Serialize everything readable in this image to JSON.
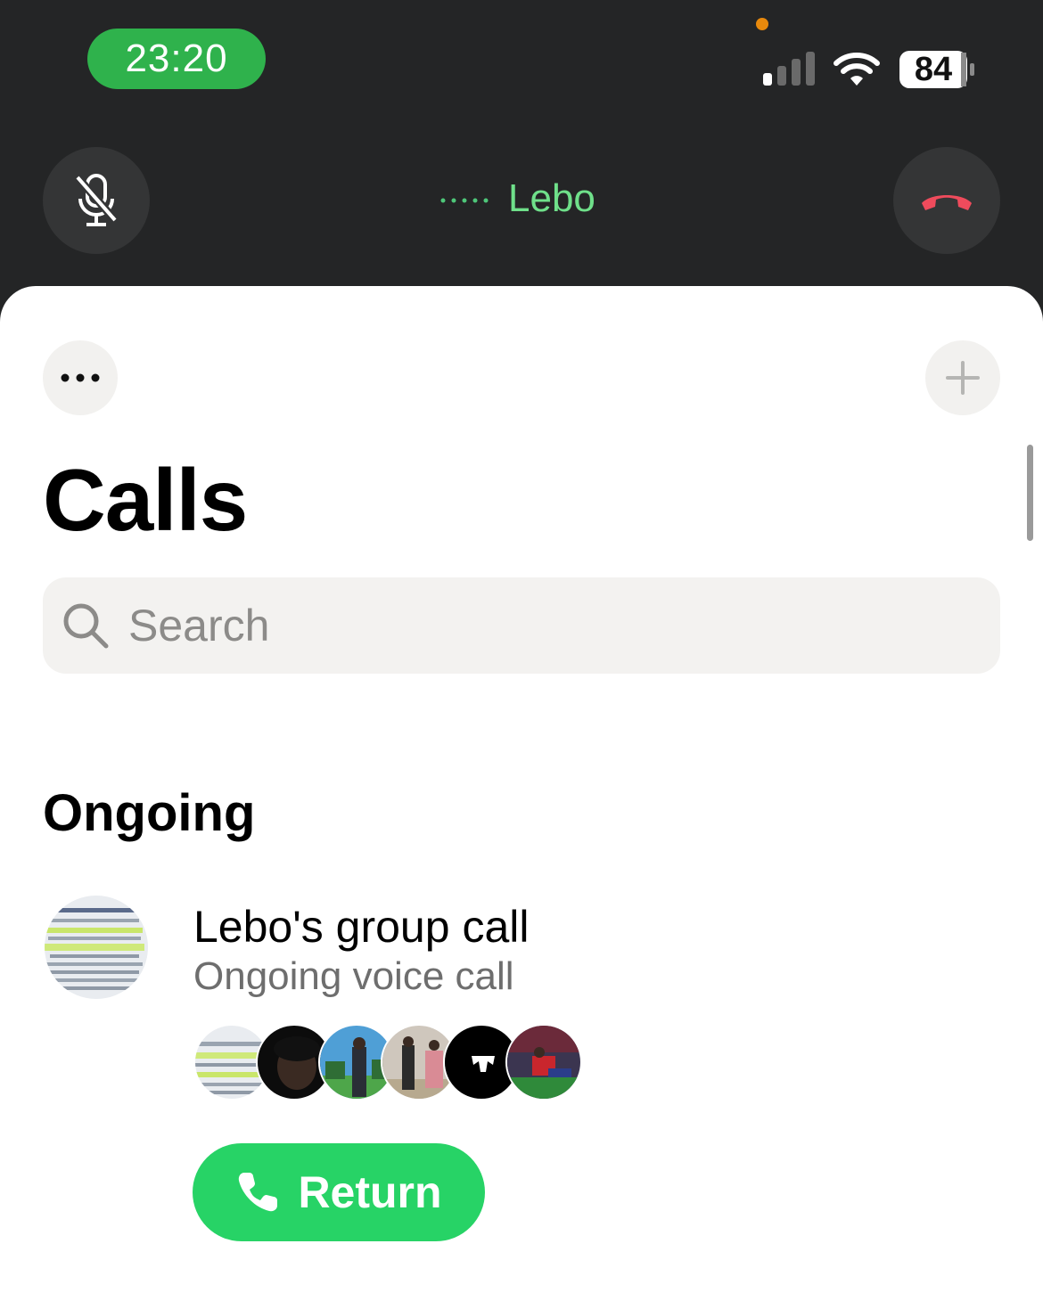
{
  "status_bar": {
    "time": "23:20",
    "battery": "84"
  },
  "call_banner": {
    "name": "Lebo"
  },
  "header": {
    "title": "Calls"
  },
  "search": {
    "placeholder": "Search"
  },
  "sections": {
    "ongoing": {
      "title": "Ongoing",
      "item": {
        "title": "Lebo's group call",
        "subtitle": "Ongoing voice call",
        "participant_count": 6,
        "return_label": "Return"
      }
    }
  },
  "colors": {
    "accent_green": "#27d366",
    "call_name_green": "#6fe08a",
    "time_pill_green": "#2fb24c",
    "end_call_red": "#ef4b5c",
    "dark_bg": "#242526"
  }
}
